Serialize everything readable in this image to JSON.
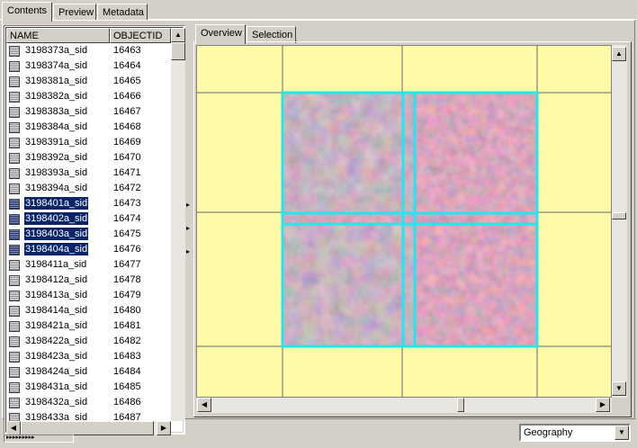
{
  "top_tabs": [
    {
      "label": "Contents",
      "active": true
    },
    {
      "label": "Preview",
      "active": false
    },
    {
      "label": "Metadata",
      "active": false
    }
  ],
  "table": {
    "columns": [
      "NAME",
      "OBJECTID"
    ],
    "rows": [
      {
        "name": "3198373a_sid",
        "objectid": "16463",
        "selected": false
      },
      {
        "name": "3198374a_sid",
        "objectid": "16464",
        "selected": false
      },
      {
        "name": "3198381a_sid",
        "objectid": "16465",
        "selected": false
      },
      {
        "name": "3198382a_sid",
        "objectid": "16466",
        "selected": false
      },
      {
        "name": "3198383a_sid",
        "objectid": "16467",
        "selected": false
      },
      {
        "name": "3198384a_sid",
        "objectid": "16468",
        "selected": false
      },
      {
        "name": "3198391a_sid",
        "objectid": "16469",
        "selected": false
      },
      {
        "name": "3198392a_sid",
        "objectid": "16470",
        "selected": false
      },
      {
        "name": "3198393a_sid",
        "objectid": "16471",
        "selected": false
      },
      {
        "name": "3198394a_sid",
        "objectid": "16472",
        "selected": false
      },
      {
        "name": "3198401a_sid",
        "objectid": "16473",
        "selected": true
      },
      {
        "name": "3198402a_sid",
        "objectid": "16474",
        "selected": true
      },
      {
        "name": "3198403a_sid",
        "objectid": "16475",
        "selected": true
      },
      {
        "name": "3198404a_sid",
        "objectid": "16476",
        "selected": true,
        "focused": true
      },
      {
        "name": "3198411a_sid",
        "objectid": "16477",
        "selected": false
      },
      {
        "name": "3198412a_sid",
        "objectid": "16478",
        "selected": false
      },
      {
        "name": "3198413a_sid",
        "objectid": "16479",
        "selected": false
      },
      {
        "name": "3198414a_sid",
        "objectid": "16480",
        "selected": false
      },
      {
        "name": "3198421a_sid",
        "objectid": "16481",
        "selected": false
      },
      {
        "name": "3198422a_sid",
        "objectid": "16482",
        "selected": false
      },
      {
        "name": "3198423a_sid",
        "objectid": "16483",
        "selected": false
      },
      {
        "name": "3198424a_sid",
        "objectid": "16484",
        "selected": false
      },
      {
        "name": "3198431a_sid",
        "objectid": "16485",
        "selected": false
      },
      {
        "name": "3198432a_sid",
        "objectid": "16486",
        "selected": false
      },
      {
        "name": "3198433a_sid",
        "objectid": "16487",
        "selected": false
      }
    ]
  },
  "preview_tabs": [
    {
      "label": "Overview",
      "active": true
    },
    {
      "label": "Selection",
      "active": false
    }
  ],
  "display_type": {
    "value": "Geography"
  },
  "colors": {
    "selection": "#0a246a",
    "map_background": "#fffaa8",
    "footprint_outline": "#22e6f0",
    "window_face": "#d4d0c8"
  },
  "icons": {
    "raster_row": "raster-dataset-icon",
    "scroll_up": "scroll-up-arrow-icon",
    "scroll_down": "scroll-down-arrow-icon",
    "scroll_left": "scroll-left-arrow-icon",
    "scroll_right": "scroll-right-arrow-icon",
    "dropdown": "chevron-down-icon"
  }
}
